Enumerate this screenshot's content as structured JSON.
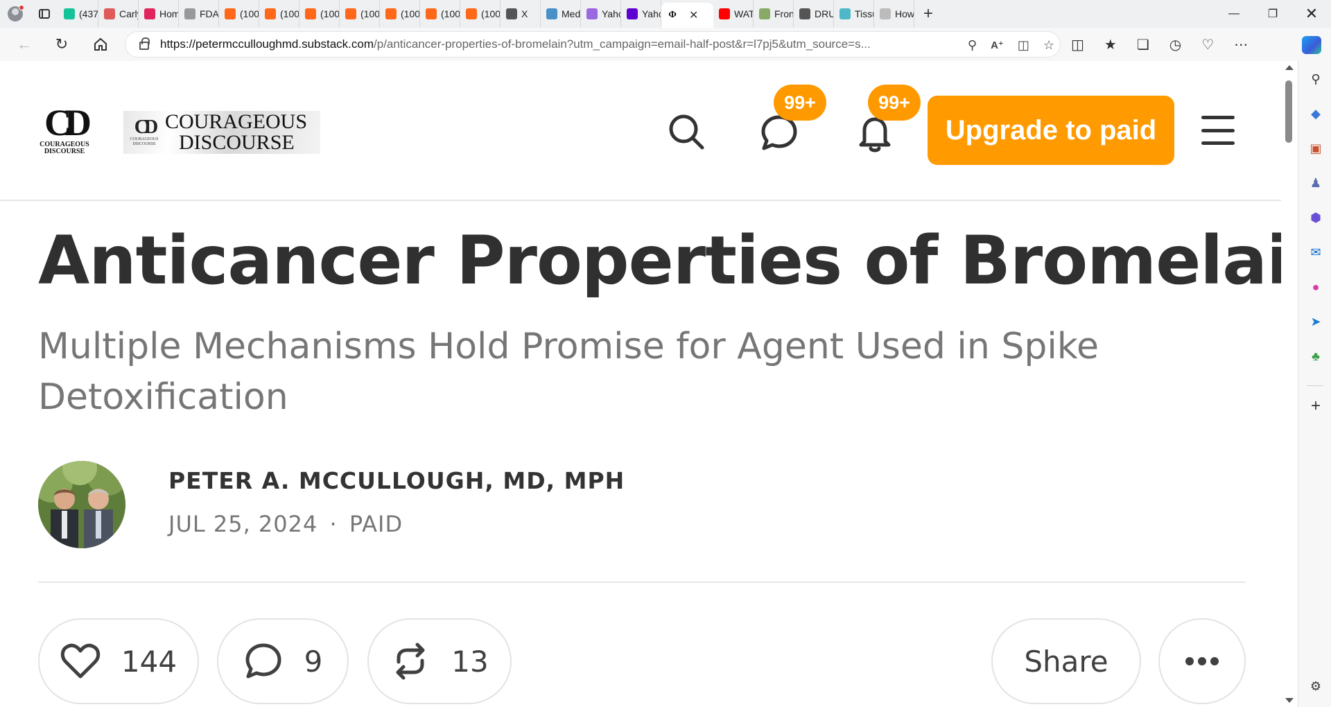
{
  "browser": {
    "tabs": [
      {
        "label": "(437",
        "icon": "grammarly-icon",
        "color": "#15c39a"
      },
      {
        "label": "Carly",
        "icon": "youtube-icon",
        "color": "#e05a5a"
      },
      {
        "label": "Hom",
        "icon": "pin-icon",
        "color": "#e0245e"
      },
      {
        "label": "FDA",
        "icon": "page-icon",
        "color": "#999999"
      },
      {
        "label": "(100",
        "icon": "substack-icon",
        "color": "#ff6719"
      },
      {
        "label": "(100",
        "icon": "substack-icon",
        "color": "#ff6719"
      },
      {
        "label": "(100",
        "icon": "substack-icon",
        "color": "#ff6719"
      },
      {
        "label": "(100",
        "icon": "substack-icon",
        "color": "#ff6719"
      },
      {
        "label": "(100",
        "icon": "substack-icon",
        "color": "#ff6719"
      },
      {
        "label": "(100",
        "icon": "substack-icon",
        "color": "#ff6719"
      },
      {
        "label": "(100",
        "icon": "substack-icon",
        "color": "#ff6719"
      },
      {
        "label": "X",
        "icon": "x-icon",
        "color": "#555555"
      },
      {
        "label": "Med",
        "icon": "medscape-icon",
        "color": "#4a90c8"
      },
      {
        "label": "Yaho",
        "icon": "yahoo-icon",
        "color": "#9a68e0"
      },
      {
        "label": "Yaho",
        "icon": "yahoo-icon",
        "color": "#5f01d1"
      },
      {
        "label": "",
        "icon": "courageous-discourse-icon",
        "color": "#ffffff",
        "active": true
      },
      {
        "label": "WAT",
        "icon": "youtube-icon",
        "color": "#ff0000"
      },
      {
        "label": "Fron",
        "icon": "pinwheel-icon",
        "color": "#88aa66"
      },
      {
        "label": "DRU",
        "icon": "drudge-icon",
        "color": "#555555"
      },
      {
        "label": "Tissu",
        "icon": "tissue-icon",
        "color": "#4fb8c8"
      },
      {
        "label": "How",
        "icon": "globe-icon",
        "color": "#bbbbbb"
      }
    ],
    "url_host": "https://petermcculloughmd.substack.com",
    "url_path": "/p/anticancer-properties-of-bromelain?utm_campaign=email-half-post&r=l7pj5&utm_source=s..."
  },
  "site": {
    "logo_mark_text": "CD",
    "logo_mark_caption_1": "COURAGEOUS",
    "logo_mark_caption_2": "DISCOURSE",
    "banner_word_1": "COURAGEOUS",
    "banner_word_2": "DISCOURSE",
    "chat_badge": "99+",
    "notif_badge": "99+",
    "upgrade_label": "Upgrade to paid"
  },
  "article": {
    "title": "Anticancer Properties of Bromelain",
    "subtitle": "Multiple Mechanisms Hold Promise for Agent Used in Spike Detoxification",
    "author": "PETER A. MCCULLOUGH, MD, MPH",
    "date": "JUL 25, 2024",
    "separator": "·",
    "access": "PAID",
    "likes": "144",
    "comments": "9",
    "restacks": "13",
    "share_label": "Share"
  },
  "colors": {
    "accent": "#ff9a00",
    "title": "#303030",
    "muted": "#767676"
  }
}
